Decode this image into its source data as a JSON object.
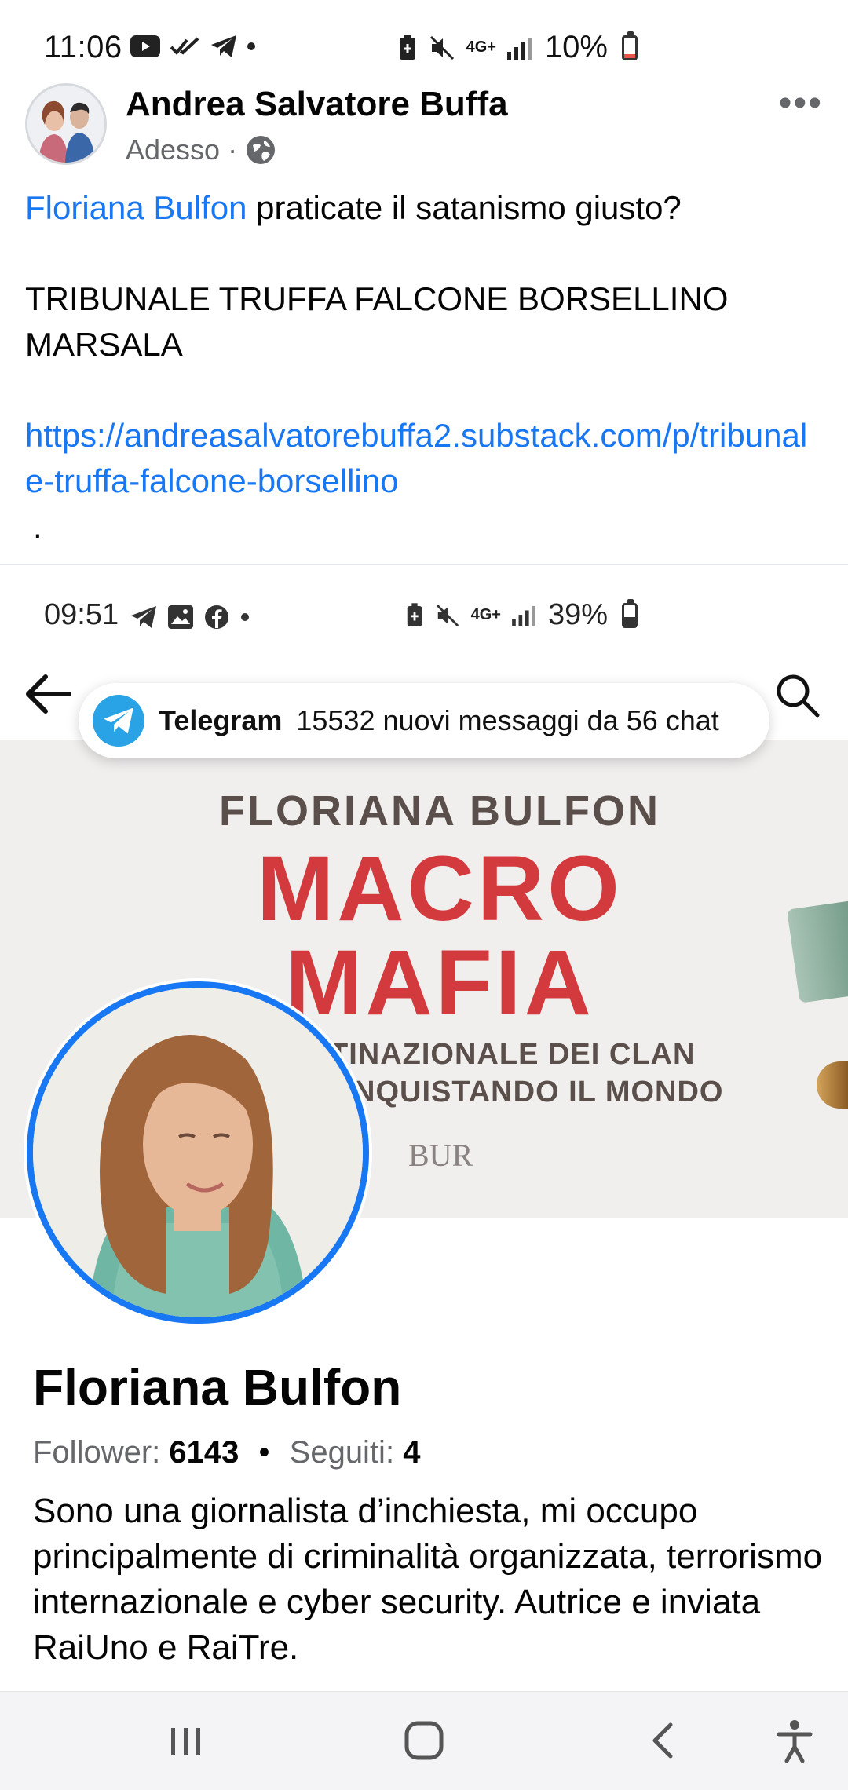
{
  "status_bar": {
    "time": "11:06",
    "battery": "10%",
    "network": "4G+",
    "icons": [
      "youtube-icon",
      "double-check-icon",
      "telegram-icon",
      "dot-icon",
      "battery-saver-icon",
      "mute-icon",
      "signal-icon"
    ],
    "battery_level": 0.1,
    "battery_color": "#e8564a"
  },
  "post": {
    "author": "Andrea Salvatore Buffa",
    "time": "Adesso",
    "separator": "·",
    "privacy_icon": "globe-icon",
    "more_label": "•••",
    "mention": "Floriana Bulfon",
    "line1_rest": " praticate il satanismo giusto?",
    "line2": "TRIBUNALE TRUFFA FALCONE BORSELLINO MARSALA",
    "link": "https://andreasalvatorebuffa2.substack.com/p/tribunale-truffa-falcone-borsellino",
    "trailing": "."
  },
  "embedded": {
    "status_bar": {
      "time": "09:51",
      "battery": "39%",
      "network": "4G+",
      "battery_level": 0.39
    },
    "notification": {
      "app": "Telegram",
      "message": "15532 nuovi messaggi da 56 chat"
    },
    "cover": {
      "author": "FLORIANA BULFON",
      "title_line1": "MACRO",
      "title_line2": "MAFIA",
      "subtitle_line1": "TINAZIONALE DEI CLAN",
      "subtitle_line2": "NQUISTANDO IL MONDO",
      "publisher": "BUR"
    },
    "profile": {
      "name": "Floriana Bulfon",
      "follower_label": "Follower:",
      "follower_count": "6143",
      "bullet": "•",
      "following_label": "Seguiti:",
      "following_count": "4",
      "bio": "Sono una giornalista d’inchiesta, mi occupo principalmente di criminalità organizzata, terrorismo internazionale e cyber security. Autrice e inviata RaiUno e RaiTre."
    }
  },
  "nav": {
    "buttons": [
      "recents-icon",
      "home-icon",
      "back-icon",
      "accessibility-icon"
    ]
  },
  "colors": {
    "link": "#1877f2",
    "secondary_text": "#65676b",
    "telegram": "#2aa3e6",
    "cover_title": "#d33a3e"
  }
}
